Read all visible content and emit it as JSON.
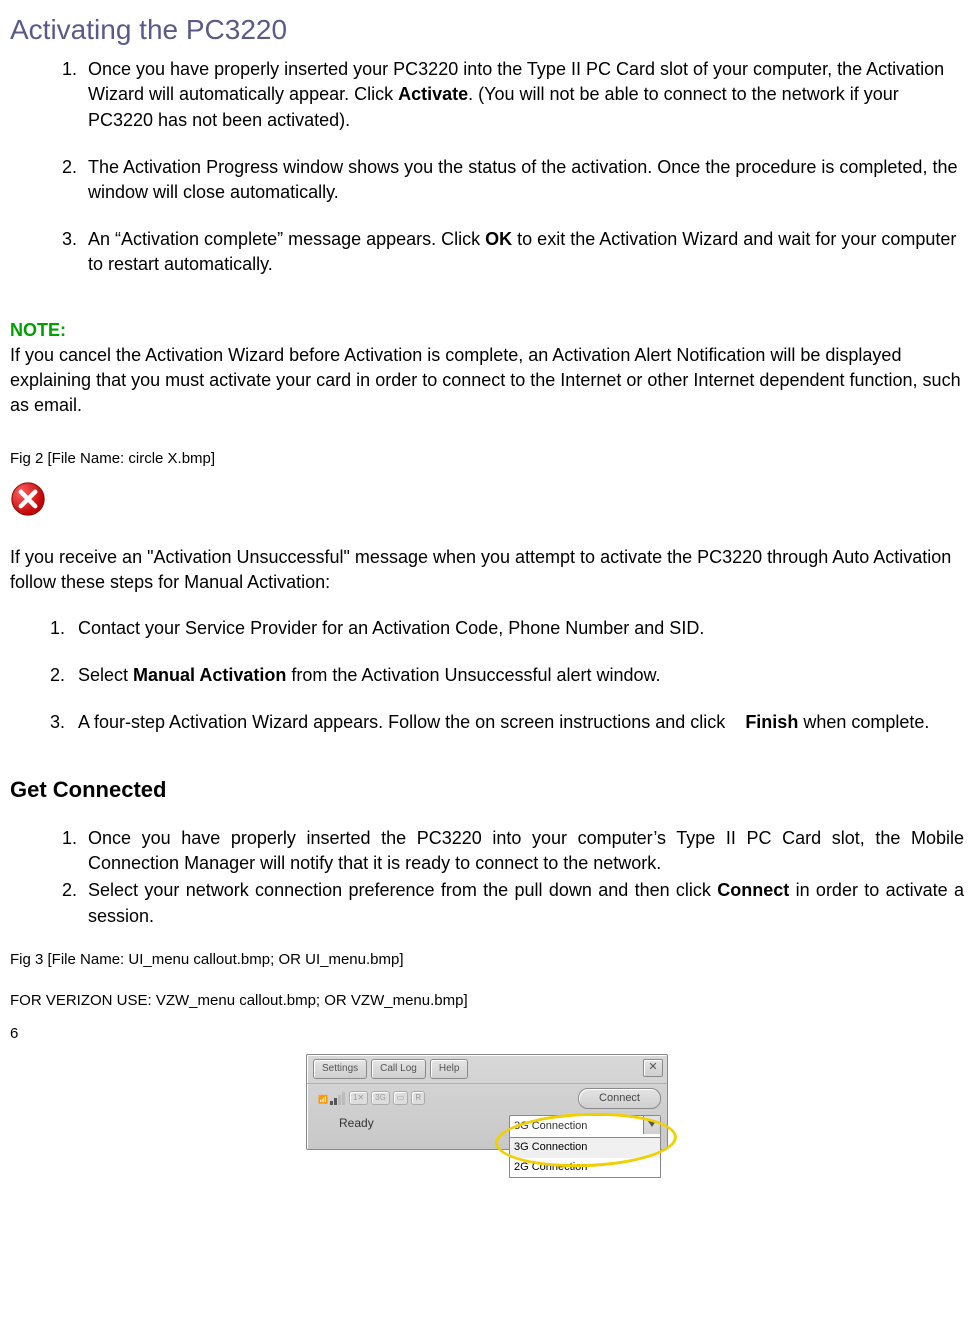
{
  "heading": "Activating the PC3220",
  "steps": [
    {
      "pre": "Once you have properly inserted your PC3220 into the Type II PC Card slot of your computer, the Activation Wizard will automatically appear. Click ",
      "bold": "Activate",
      "post": ". (You will not be able to connect to the network if your PC3220 has not been activated)."
    },
    {
      "pre": "The Activation Progress window shows you the status of the activation. Once the procedure is completed, the window will close automatically.",
      "bold": "",
      "post": ""
    },
    {
      "pre": "An “Activation complete” message appears. Click ",
      "bold": "OK",
      "post": " to exit the Activation Wizard and wait for your computer to restart automatically."
    }
  ],
  "note_label": "NOTE:",
  "note_body": "If you cancel the Activation Wizard before Activation is complete, an Activation Alert Notification will be displayed explaining that you must activate your card in order to connect to the Internet or other Internet dependent function, such as email.",
  "fig2_caption": "Fig 2 [File Name: circle X.bmp]",
  "unsuccessful_intro": "If you receive an \"Activation Unsuccessful\" message when you attempt to activate the PC3220 through Auto Activation follow these steps for Manual Activation:",
  "manual_steps": [
    {
      "num": "1.",
      "pre": "Contact your Service Provider for an Activation Code, Phone Number and SID.",
      "bold": "",
      "post": ""
    },
    {
      "num": "2.",
      "pre": "Select ",
      "bold": "Manual Activation",
      "post": " from the Activation Unsuccessful alert window."
    },
    {
      "num": "3.",
      "pre": "A four-step Activation Wizard appears. Follow the on screen instructions and click    ",
      "bold": "Finish",
      "post": " when complete."
    }
  ],
  "get_connected_heading": "Get Connected",
  "gc_steps": [
    {
      "pre": "Once you have properly inserted the PC3220 into your computer’s Type II PC Card slot, the Mobile Connection Manager will notify that it is ready to connect to the network.",
      "bold": "",
      "post": ""
    },
    {
      "pre": "Select your network connection preference from the pull down and then click ",
      "bold": "Connect",
      "post": " in order to activate a session."
    }
  ],
  "fig3_caption": "Fig 3 [File Name: UI_menu callout.bmp; OR UI_menu.bmp]",
  "fig3_verizon": "FOR VERIZON USE:  VZW_menu callout.bmp; OR VZW_menu.bmp]",
  "page_number": "6",
  "ui": {
    "buttons": {
      "settings": "Settings",
      "calllog": "Call Log",
      "help": "Help"
    },
    "status_text": "Ready",
    "connect_label": "Connect",
    "select_value": "3G Connection",
    "options": [
      "3G Connection",
      "2G Connection"
    ],
    "icons": {
      "three_g": "3G",
      "battery": "▭",
      "roam": "R"
    }
  }
}
